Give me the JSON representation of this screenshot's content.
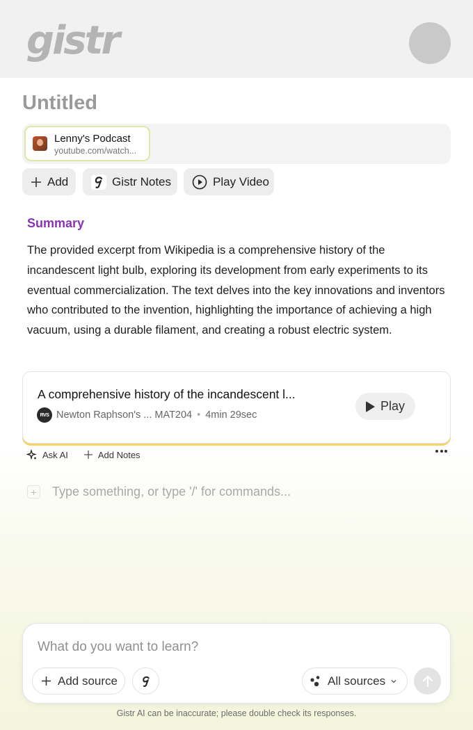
{
  "header": {
    "logo_text": "gistr",
    "avatar": "user-avatar"
  },
  "document": {
    "title": "Untitled"
  },
  "sources": [
    {
      "name": "Lenny's Podcast",
      "url": "youtube.com/watch..."
    }
  ],
  "actions": {
    "add_label": "Add",
    "gistr_notes_label": "Gistr Notes",
    "play_video_label": "Play Video"
  },
  "summary": {
    "heading": "Summary",
    "text": "The provided excerpt from Wikipedia is a comprehensive history of the incandescent light bulb, exploring its development from early experiments to its eventual commercialization. The text delves into the key innovations and inventors who contributed to the invention, highlighting the importance of achieving a high vacuum, using a durable filament, and creating a robust electric system."
  },
  "episode": {
    "title": "A comprehensive history of the incandescent l...",
    "channel_logo_text": "RVS",
    "channel": "Newton Raphson's ... MAT204",
    "separator": "•",
    "duration": "4min 29sec",
    "play_label": "Play"
  },
  "toolbar": {
    "ask_ai_label": "Ask AI",
    "add_notes_label": "Add Notes"
  },
  "editor": {
    "placeholder": "Type something, or type '/' for commands..."
  },
  "composer": {
    "placeholder": "What do you want to learn?",
    "add_source_label": "Add source",
    "all_sources_label": "All sources"
  },
  "footer": {
    "disclaimer": "Gistr AI can be inaccurate; please double check its responses."
  },
  "colors": {
    "accent_purple": "#8a33b8",
    "highlight_yellow": "#f7d46a",
    "chip_border": "#dfe8a5"
  }
}
